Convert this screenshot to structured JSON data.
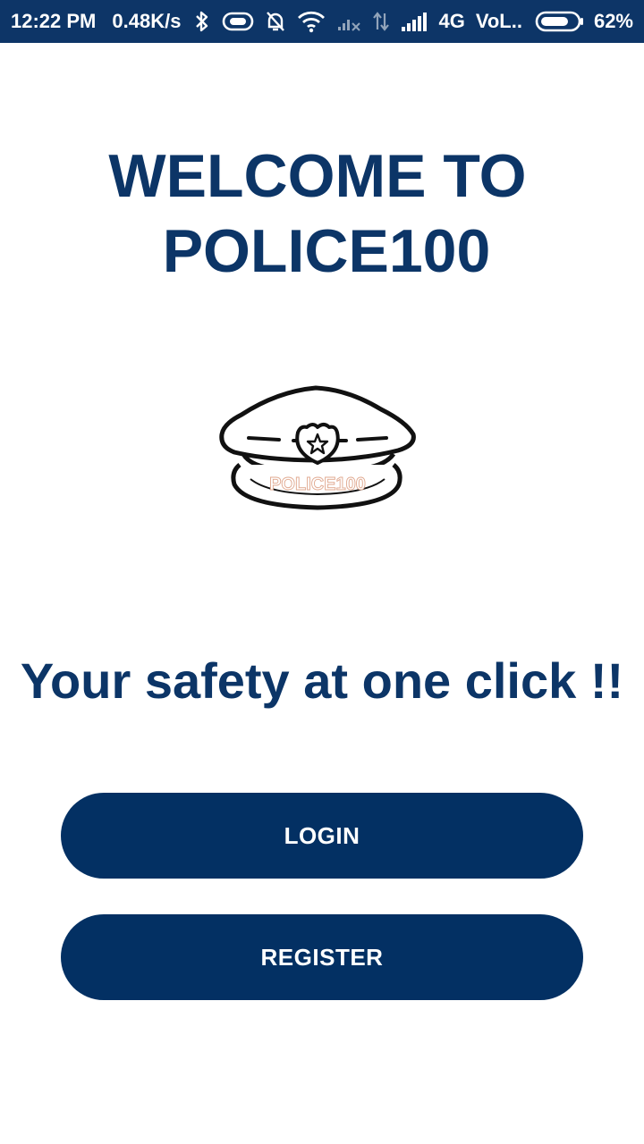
{
  "status_bar": {
    "time": "12:22 PM",
    "speed": "0.48K/s",
    "network": "4G",
    "carrier": "VoL..",
    "battery": "62%",
    "icons": [
      "bluetooth-icon",
      "vibrate-icon",
      "mute-icon",
      "wifi-icon",
      "signal-weak-icon",
      "data-arrows-icon",
      "signal-icon",
      "battery-icon"
    ]
  },
  "welcome": {
    "line1": "WELCOME TO",
    "line2": "POLICE100"
  },
  "logo": {
    "icon": "police-cap-icon",
    "text": "POLICE100"
  },
  "tagline": "Your safety at one click !!",
  "buttons": {
    "login_label": "LOGIN",
    "register_label": "REGISTER"
  },
  "colors": {
    "status_bar": "#0d3567",
    "title": "#0c3567",
    "button": "#033063",
    "background": "#ffffff"
  }
}
